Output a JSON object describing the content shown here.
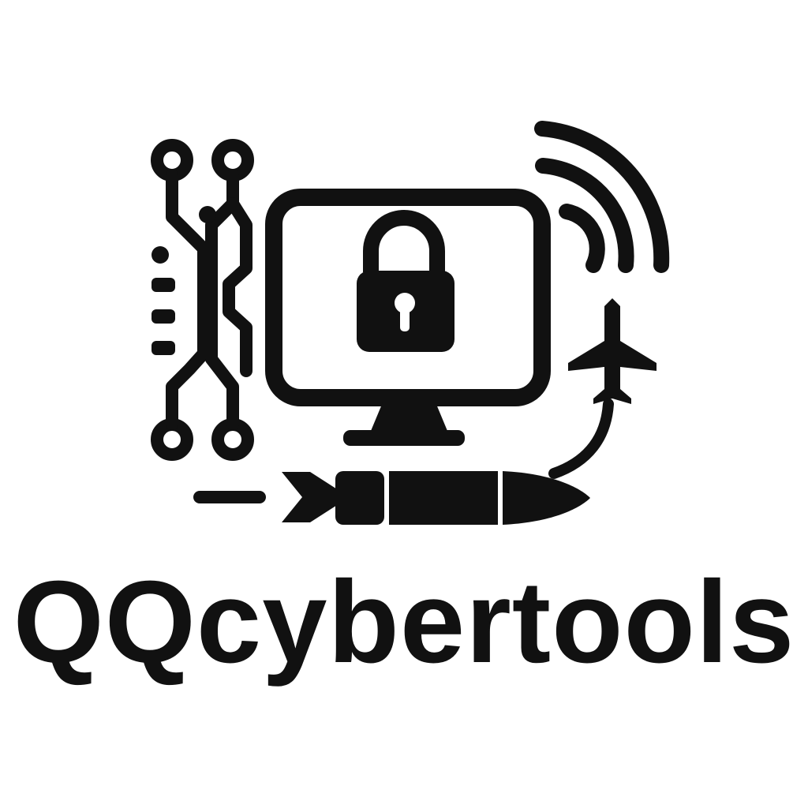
{
  "logo": {
    "wordmark": "QQcybertools",
    "color": "#111111",
    "background": "#ffffff",
    "icons": [
      "circuit-traces-icon",
      "monitor-icon",
      "padlock-icon",
      "signal-waves-icon",
      "airplane-icon",
      "missile-icon"
    ]
  }
}
